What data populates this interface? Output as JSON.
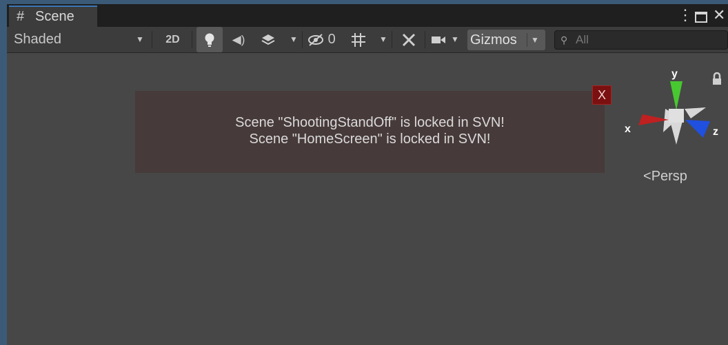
{
  "tab": {
    "title": "Scene",
    "icon": "hash-icon"
  },
  "window_controls": {
    "menu_icon": "kebab-menu-icon",
    "maximize_icon": "maximize-icon",
    "close_icon": "close-icon",
    "close_glyph": "✕"
  },
  "toolbar": {
    "draw_mode": "Shaded",
    "mode_2d": "2D",
    "hidden_count": "0",
    "gizmos": "Gizmos",
    "search_placeholder": "All",
    "icons": [
      "lightbulb-icon",
      "audio-icon",
      "effects-icon",
      "visibility-icon",
      "grid-icon",
      "tools-icon",
      "camera-icon"
    ]
  },
  "notification": {
    "line1": "Scene \"ShootingStandOff\" is locked in SVN!",
    "line2": "Scene \"HomeScreen\" is locked in SVN!",
    "close_label": "X"
  },
  "orientation_gizmo": {
    "y_label": "y",
    "x_label": "x",
    "z_label": "z",
    "projection": "Persp",
    "projection_prefix": "<"
  },
  "colors": {
    "tab_accent": "#3a79bb",
    "notification_bg": "#473a3a",
    "close_bg": "#7a1010",
    "axis_y": "#48c830",
    "axis_x": "#c02020",
    "axis_z": "#2050e0"
  }
}
